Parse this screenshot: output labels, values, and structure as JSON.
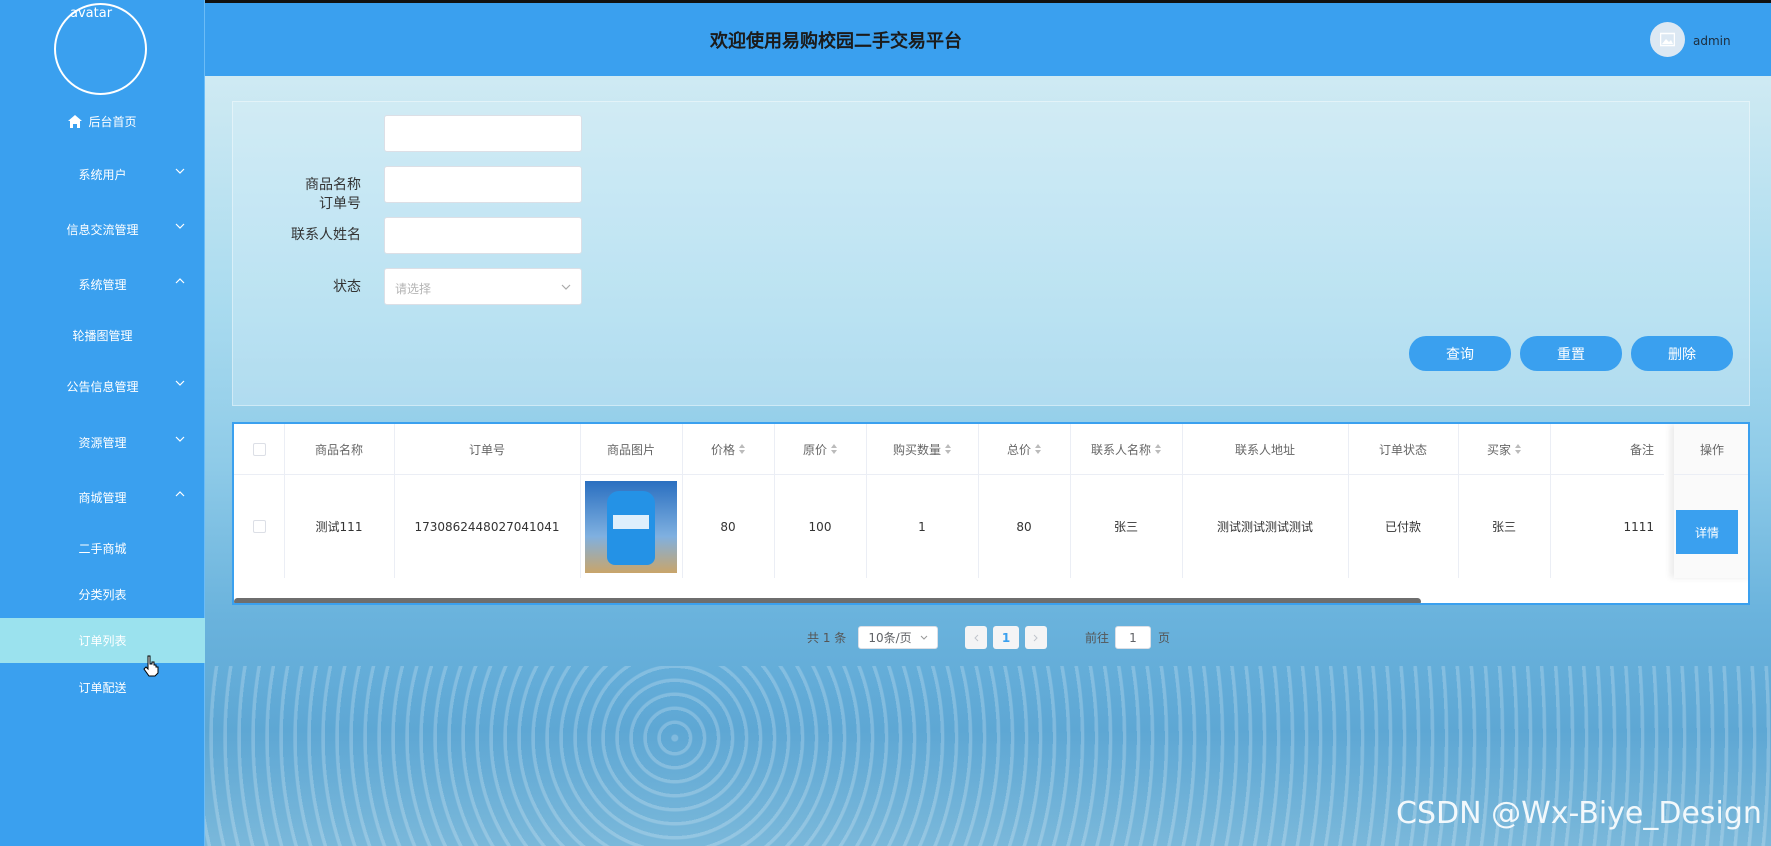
{
  "sidebar": {
    "avatar_alt": "avatar",
    "items": [
      {
        "label": "后台首页",
        "icon": "home-icon"
      },
      {
        "label": "系统用户",
        "chevron": "down"
      },
      {
        "label": "信息交流管理",
        "chevron": "down"
      },
      {
        "label": "系统管理",
        "chevron": "up"
      },
      {
        "label": "轮播图管理"
      },
      {
        "label": "公告信息管理",
        "chevron": "down"
      },
      {
        "label": "资源管理",
        "chevron": "down"
      },
      {
        "label": "商城管理",
        "chevron": "up"
      },
      {
        "label": "二手商城"
      },
      {
        "label": "分类列表"
      },
      {
        "label": "订单列表",
        "active": true
      },
      {
        "label": "订单配送"
      }
    ]
  },
  "header": {
    "title": "欢迎使用易购校园二手交易平台",
    "user_name": "admin"
  },
  "search": {
    "fields": [
      {
        "label": "订单号",
        "value": ""
      },
      {
        "label": "商品名称",
        "value": ""
      },
      {
        "label": "联系人姓名",
        "value": ""
      }
    ],
    "status_label": "状态",
    "status_placeholder": "请选择",
    "buttons": {
      "query": "查询",
      "reset": "重置",
      "delete": "删除"
    }
  },
  "table": {
    "headers": [
      "商品名称",
      "订单号",
      "商品图片",
      "价格",
      "原价",
      "购买数量",
      "总价",
      "联系人名称",
      "联系人地址",
      "订单状态",
      "买家",
      "备注",
      "操作"
    ],
    "rows": [
      {
        "product_name": "测试111",
        "order_no": "1730862448027041041",
        "price": "80",
        "original_price": "100",
        "quantity": "1",
        "total": "80",
        "contact_name": "张三",
        "contact_address": "测试测试测试测试",
        "order_status": "已付款",
        "buyer": "张三",
        "remark": "1111",
        "action": "详情"
      }
    ]
  },
  "pagination": {
    "total_text": "共 1 条",
    "page_size": "10条/页",
    "current_page": "1",
    "goto_prefix": "前往",
    "goto_value": "1",
    "goto_suffix": "页"
  },
  "watermark": "CSDN @Wx-Biye_Design",
  "colors": {
    "primary": "#3aa0ef",
    "active_item": "#9be2ee"
  }
}
